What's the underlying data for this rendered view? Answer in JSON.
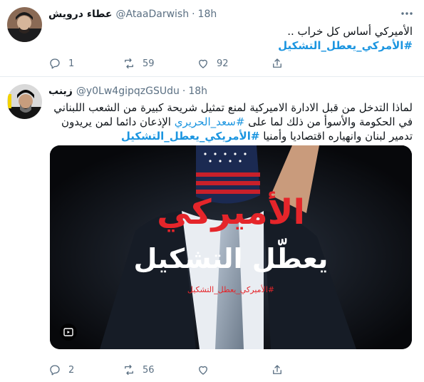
{
  "tweets": [
    {
      "name": "عطاء درويش",
      "handle": "@AtaaDarwish",
      "separator": "·",
      "time": "18h",
      "line1": "الأميركي أساس كل خراب ..",
      "hashtag": "#الأمركي_يعطل_التشكيل",
      "counts": {
        "reply": "1",
        "retweet": "59",
        "like": "92"
      }
    },
    {
      "name": "زينب",
      "handle": "@y0Lw4gipqzGSUdu",
      "separator": "·",
      "time": "18h",
      "text_a": "لماذا التدخل من قبل الادارة الاميركية لمنع تمثيل شريحة كبيرة من الشعب اللبناني في الحكومة والأسوأ من ذلك لما على ",
      "mention_hashtag": "#سعد_الحريري",
      "text_b": " الإذعان دائما لمن يريدون تدمير لبنان وانهياره اقتصاديا وأمنيا ",
      "hashtag": "#الأمريكي_يعطل_التشكيل",
      "media": {
        "headline1": "الأميركي",
        "headline2": "يعطّل التشكيل",
        "tag": "#الأميركي_يعطل_التشكيل"
      },
      "counts": {
        "reply": "2",
        "retweet": "56",
        "like": ""
      }
    }
  ],
  "icons": {
    "reply": "reply-icon",
    "retweet": "retweet-icon",
    "like": "heart-icon",
    "share": "share-icon",
    "more": "more-icon",
    "gif": "gif-icon"
  },
  "colors": {
    "link": "#1b95e0",
    "secondary": "#5b7083",
    "media_red": "#e5252a"
  }
}
